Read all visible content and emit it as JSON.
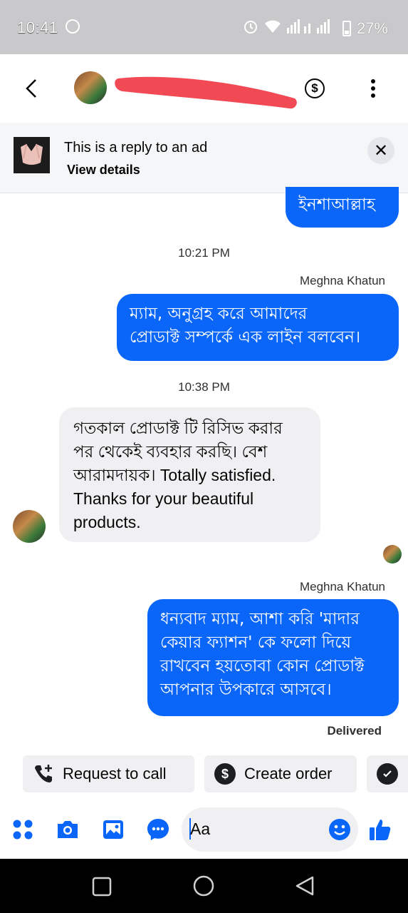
{
  "status_bar": {
    "time": "10:41",
    "battery": "27%"
  },
  "header": {
    "contact_name": ""
  },
  "ad_banner": {
    "title": "This is a reply to an ad",
    "link": "View details"
  },
  "messages": [
    {
      "text": "ইনশাআল্লাহ"
    },
    {
      "timestamp": "10:21 PM"
    },
    {
      "sender": "Meghna Khatun",
      "lines": [
        "ম্যাম, অনুগ্রহ করে আমাদের",
        "প্রোডাক্ট সম্পর্কে এক লাইন বলবেন।"
      ]
    },
    {
      "timestamp": "10:38 PM"
    },
    {
      "lines": [
        "গতকাল প্রোডাক্ট টি রিসিভ করার",
        "পর থেকেই ব্যবহার করছি। বেশ",
        "আরামদায়ক। Totally satisfied.",
        "Thanks for your beautiful",
        "products."
      ]
    },
    {
      "sender": "Meghna Khatun",
      "lines": [
        "ধন্যবাদ ম্যাম, আশা করি 'মাদার",
        "কেয়ার ফ্যাশন' কে ফলো দিয়ে",
        "রাখবেন হয়তোবা কোন প্রোডাক্ট",
        "আপনার উপকারে আসবে।"
      ]
    }
  ],
  "delivered": "Delivered",
  "quick_actions": [
    {
      "label": "Request to call",
      "icon": "phone-plus-icon"
    },
    {
      "label": "Create order",
      "icon": "dollar-icon"
    },
    {
      "label": "",
      "icon": "check-circle-icon"
    }
  ],
  "composer": {
    "placeholder": "Aa"
  },
  "colors": {
    "accent": "#0a66f9",
    "incoming_bubble": "#f0f0f2",
    "status_bar": "#c9c9cb"
  }
}
